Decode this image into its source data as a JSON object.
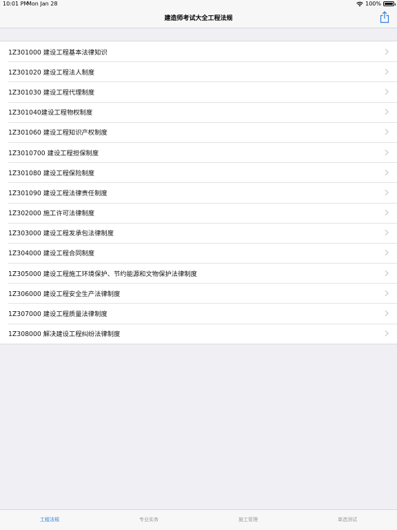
{
  "status_bar": {
    "time": "10:01 PM",
    "date": "Mon Jan 28",
    "battery": "100%"
  },
  "nav": {
    "title": "建造师考试大全工程法规"
  },
  "list_items": [
    "1Z301000 建设工程基本法律知识",
    "1Z301020 建设工程法人制度",
    "1Z301030 建设工程代理制度",
    "1Z301040建设工程物权制度",
    "1Z301060 建设工程知识产权制度",
    "1Z3010700 建设工程担保制度",
    "1Z301080 建设工程保险制度",
    "1Z301090 建设工程法律责任制度",
    "1Z302000 施工许可法律制度",
    "1Z303000 建设工程发承包法律制度",
    "1Z304000 建设工程合同制度",
    "1Z305000 建设工程施工环境保护、节约能源和文物保护法律制度",
    "1Z306000 建设工程安全生产法律制度",
    "1Z307000 建设工程质量法律制度",
    "1Z308000 解决建设工程纠纷法律制度"
  ],
  "tabs": [
    {
      "label": "工程法规",
      "active": true
    },
    {
      "label": "专业实务",
      "active": false
    },
    {
      "label": "施工管理",
      "active": false
    },
    {
      "label": "单选测试",
      "active": false
    }
  ],
  "colors": {
    "accent": "#2f7de1",
    "inactive_tab": "#9a9a9f",
    "background": "#efeff4"
  }
}
